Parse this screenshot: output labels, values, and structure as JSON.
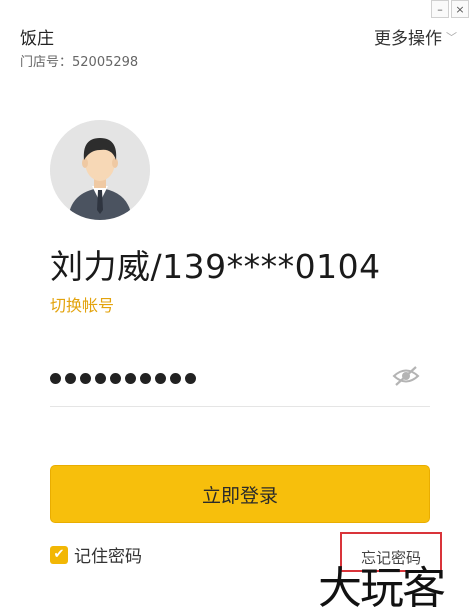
{
  "window": {
    "minimize_label": "–",
    "close_label": "×"
  },
  "store": {
    "name": "饭庄",
    "id_text": "门店号：52005298"
  },
  "header": {
    "more_actions_label": "更多操作",
    "chevron": "﹀"
  },
  "user": {
    "display_name": "刘力威/139****0104",
    "switch_account_label": "切换帐号"
  },
  "password": {
    "masked_count": 10
  },
  "login": {
    "button_label": "立即登录"
  },
  "remember": {
    "label": "记住密码",
    "checked": true,
    "check_glyph": "✔"
  },
  "forgot": {
    "label": "忘记密码"
  },
  "watermark": {
    "text": "大玩客"
  },
  "colors": {
    "accent": "#f7bf0c",
    "link": "#e3a30d",
    "highlight_box": "#d9343a"
  }
}
